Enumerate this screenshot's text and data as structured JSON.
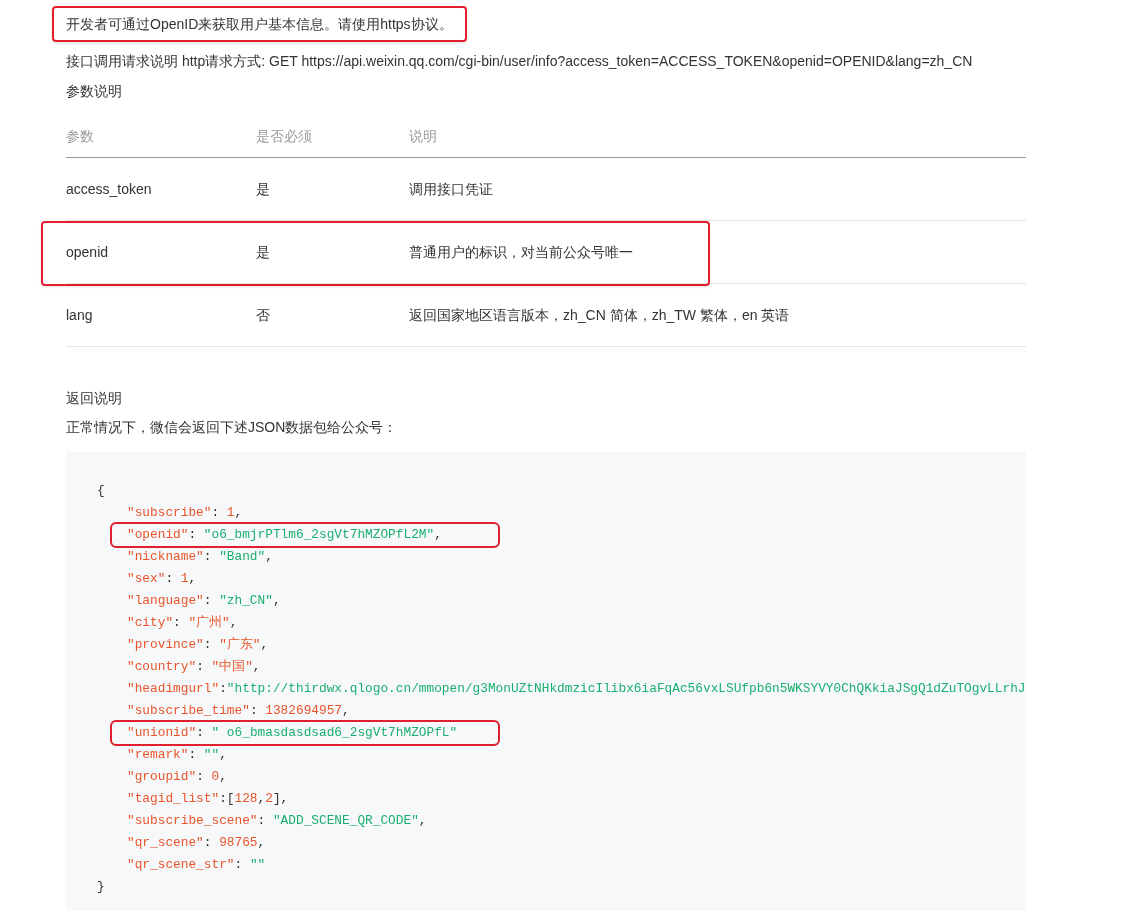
{
  "intro": {
    "text": "开发者可通过OpenID来获取用户基本信息。请使用https协议。",
    "highlighted": true
  },
  "request_line": "接口调用请求说明 http请求方式: GET https://api.weixin.qq.com/cgi-bin/user/info?access_token=ACCESS_TOKEN&openid=OPENID&lang=zh_CN",
  "params_heading": "参数说明",
  "table": {
    "columns": [
      "参数",
      "是否必须",
      "说明"
    ],
    "rows": [
      {
        "cells": [
          "access_token",
          "是",
          "调用接口凭证"
        ],
        "highlighted": false
      },
      {
        "cells": [
          "openid",
          "是",
          "普通用户的标识，对当前公众号唯一"
        ],
        "highlighted": true
      },
      {
        "cells": [
          "lang",
          "否",
          "返回国家地区语言版本，zh_CN 简体，zh_TW 繁体，en 英语"
        ],
        "highlighted": false
      }
    ]
  },
  "return_heading": "返回说明",
  "return_text": "正常情况下，微信会返回下述JSON数据包给公众号：",
  "code": {
    "open": "{",
    "close": "}",
    "lines": [
      {
        "highlighted": false,
        "tokens": [
          {
            "kind": "key",
            "text": "\"subscribe\""
          },
          {
            "kind": "punct",
            "text": ": "
          },
          {
            "kind": "number",
            "text": "1"
          },
          {
            "kind": "punct",
            "text": ","
          }
        ]
      },
      {
        "highlighted": true,
        "tokens": [
          {
            "kind": "key",
            "text": "\"openid\""
          },
          {
            "kind": "punct",
            "text": ": "
          },
          {
            "kind": "string",
            "text": "\"o6_bmjrPTlm6_2sgVt7hMZOPfL2M\""
          },
          {
            "kind": "punct",
            "text": ","
          }
        ]
      },
      {
        "highlighted": false,
        "tokens": [
          {
            "kind": "key",
            "text": "\"nickname\""
          },
          {
            "kind": "punct",
            "text": ": "
          },
          {
            "kind": "string",
            "text": "\"Band\""
          },
          {
            "kind": "punct",
            "text": ","
          }
        ]
      },
      {
        "highlighted": false,
        "tokens": [
          {
            "kind": "key",
            "text": "\"sex\""
          },
          {
            "kind": "punct",
            "text": ": "
          },
          {
            "kind": "number",
            "text": "1"
          },
          {
            "kind": "punct",
            "text": ","
          }
        ]
      },
      {
        "highlighted": false,
        "tokens": [
          {
            "kind": "key",
            "text": "\"language\""
          },
          {
            "kind": "punct",
            "text": ": "
          },
          {
            "kind": "string",
            "text": "\"zh_CN\""
          },
          {
            "kind": "punct",
            "text": ","
          }
        ]
      },
      {
        "highlighted": false,
        "tokens": [
          {
            "kind": "key",
            "text": "\"city\""
          },
          {
            "kind": "punct",
            "text": ": "
          },
          {
            "kind": "key",
            "text": "\"广州\""
          },
          {
            "kind": "punct",
            "text": ","
          }
        ]
      },
      {
        "highlighted": false,
        "tokens": [
          {
            "kind": "key",
            "text": "\"province\""
          },
          {
            "kind": "punct",
            "text": ": "
          },
          {
            "kind": "key",
            "text": "\"广东\""
          },
          {
            "kind": "punct",
            "text": ","
          }
        ]
      },
      {
        "highlighted": false,
        "tokens": [
          {
            "kind": "key",
            "text": "\"country\""
          },
          {
            "kind": "punct",
            "text": ": "
          },
          {
            "kind": "key",
            "text": "\"中国\""
          },
          {
            "kind": "punct",
            "text": ","
          }
        ]
      },
      {
        "highlighted": false,
        "tokens": [
          {
            "kind": "key",
            "text": "\"headimgurl\""
          },
          {
            "kind": "punct",
            "text": ":"
          },
          {
            "kind": "string",
            "text": "\"http://thirdwx.qlogo.cn/mmopen/g3MonUZtNHkdmzicIlibx6iaFqAc56vxLSUfpb6n5WKSYVY0ChQKkiaJSgQ1dZuTOgvLLrhJ"
          }
        ]
      },
      {
        "highlighted": false,
        "tokens": [
          {
            "kind": "key",
            "text": "\"subscribe_time\""
          },
          {
            "kind": "punct",
            "text": ": "
          },
          {
            "kind": "number",
            "text": "1382694957"
          },
          {
            "kind": "punct",
            "text": ","
          }
        ]
      },
      {
        "highlighted": true,
        "tokens": [
          {
            "kind": "key",
            "text": "\"unionid\""
          },
          {
            "kind": "punct",
            "text": ": "
          },
          {
            "kind": "string",
            "text": "\" o6_bmasdasdsad6_2sgVt7hMZOPfL\""
          }
        ]
      },
      {
        "highlighted": false,
        "tokens": [
          {
            "kind": "key",
            "text": "\"remark\""
          },
          {
            "kind": "punct",
            "text": ": "
          },
          {
            "kind": "string",
            "text": "\"\""
          },
          {
            "kind": "punct",
            "text": ","
          }
        ]
      },
      {
        "highlighted": false,
        "tokens": [
          {
            "kind": "key",
            "text": "\"groupid\""
          },
          {
            "kind": "punct",
            "text": ": "
          },
          {
            "kind": "number",
            "text": "0"
          },
          {
            "kind": "punct",
            "text": ","
          }
        ]
      },
      {
        "highlighted": false,
        "tokens": [
          {
            "kind": "key",
            "text": "\"tagid_list\""
          },
          {
            "kind": "punct",
            "text": ":["
          },
          {
            "kind": "number",
            "text": "128"
          },
          {
            "kind": "punct",
            "text": ","
          },
          {
            "kind": "number",
            "text": "2"
          },
          {
            "kind": "punct",
            "text": "],"
          }
        ]
      },
      {
        "highlighted": false,
        "tokens": [
          {
            "kind": "key",
            "text": "\"subscribe_scene\""
          },
          {
            "kind": "punct",
            "text": ": "
          },
          {
            "kind": "string",
            "text": "\"ADD_SCENE_QR_CODE\""
          },
          {
            "kind": "punct",
            "text": ","
          }
        ]
      },
      {
        "highlighted": false,
        "tokens": [
          {
            "kind": "key",
            "text": "\"qr_scene\""
          },
          {
            "kind": "punct",
            "text": ": "
          },
          {
            "kind": "number",
            "text": "98765"
          },
          {
            "kind": "punct",
            "text": ","
          }
        ]
      },
      {
        "highlighted": false,
        "tokens": [
          {
            "kind": "key",
            "text": "\"qr_scene_str\""
          },
          {
            "kind": "punct",
            "text": ": "
          },
          {
            "kind": "string",
            "text": "\"\""
          }
        ]
      }
    ]
  }
}
